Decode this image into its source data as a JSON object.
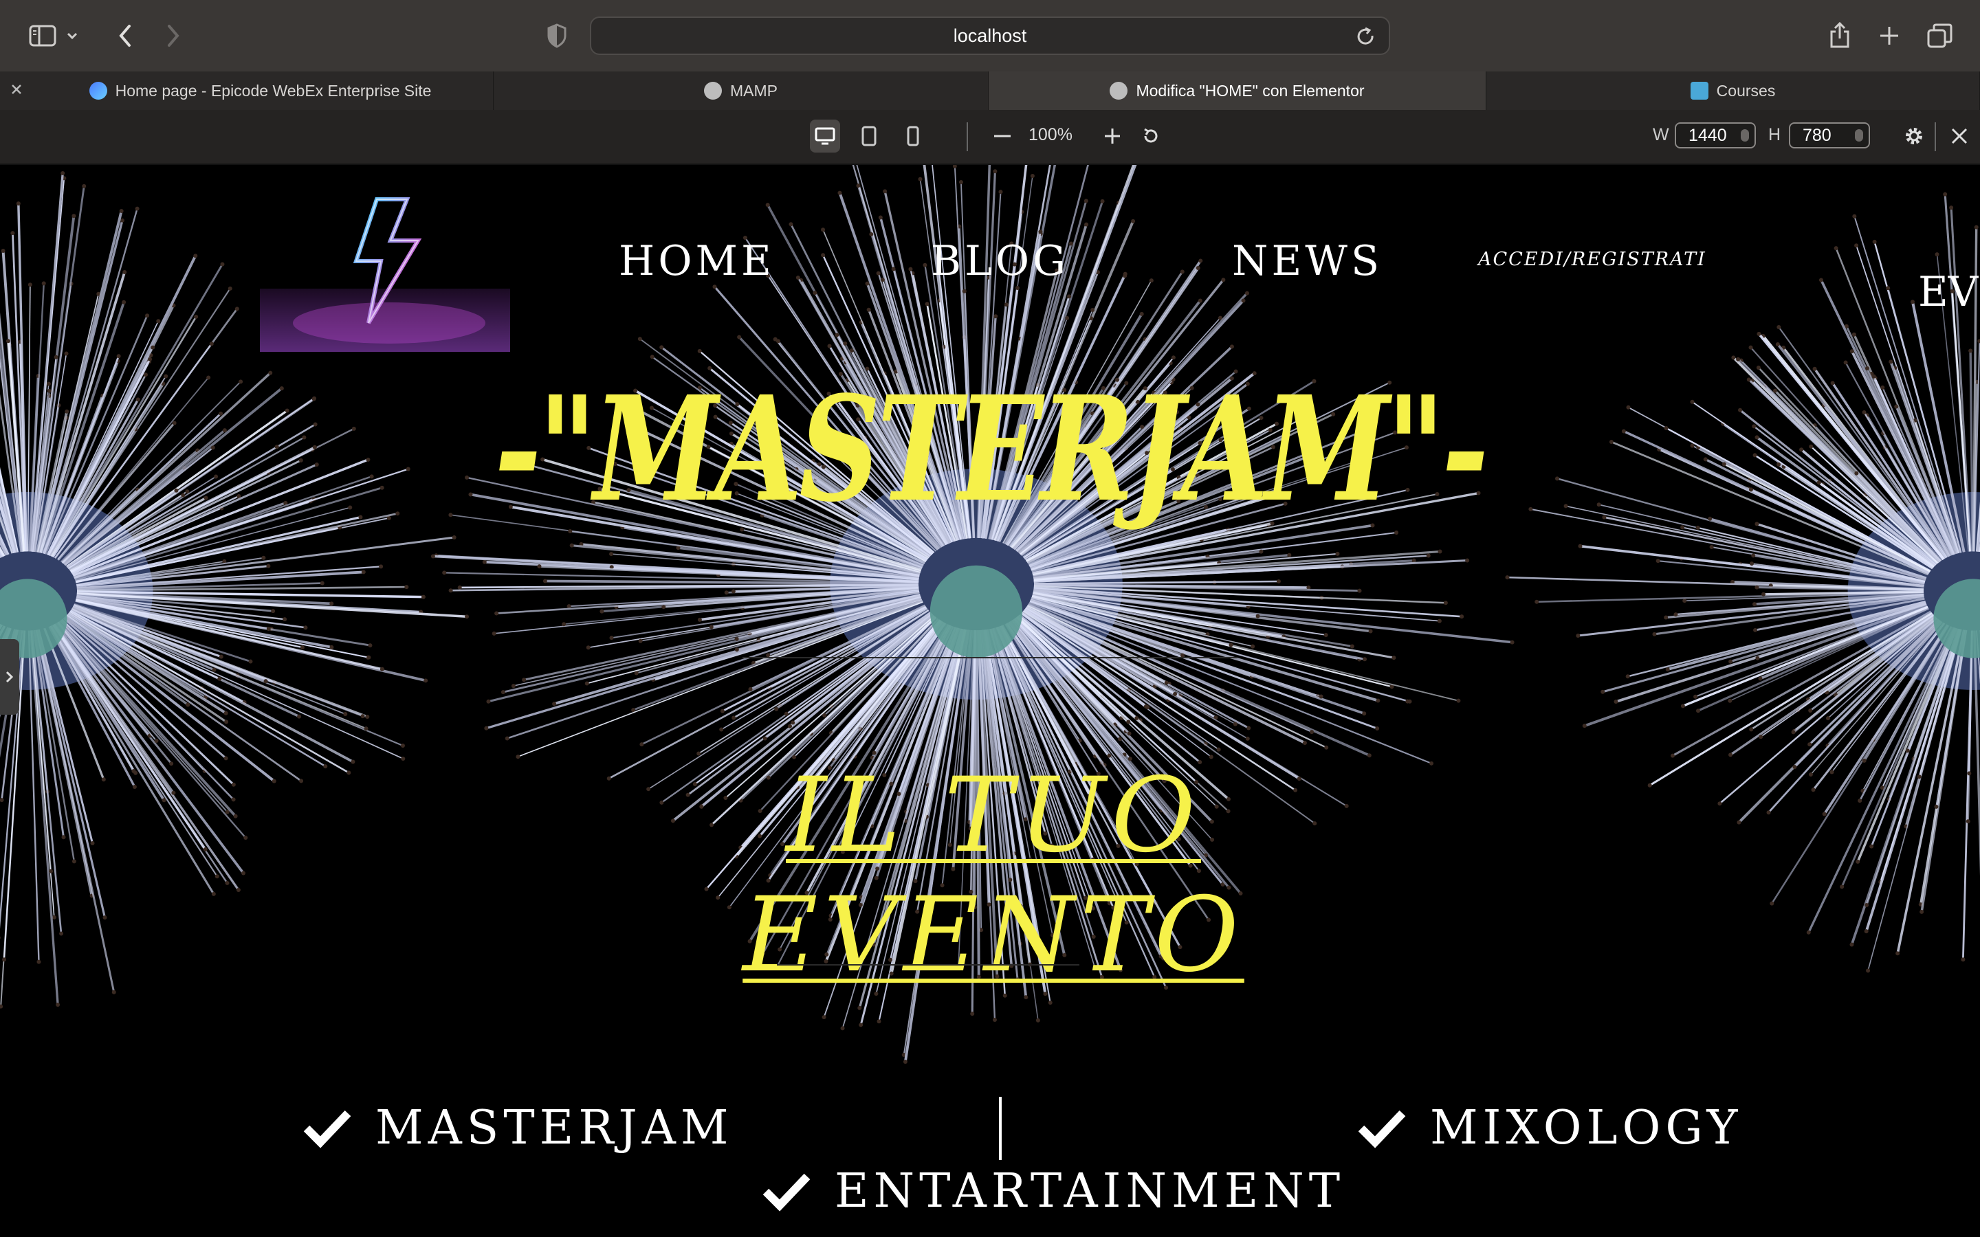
{
  "browser": {
    "address": "localhost",
    "tabs": [
      {
        "label": "Home page - Epicode WebEx Enterprise Site",
        "active": false
      },
      {
        "label": "MAMP",
        "active": false
      },
      {
        "label": "Modifica \"HOME\" con Elementor",
        "active": true
      },
      {
        "label": "Courses",
        "active": false
      }
    ],
    "responsive": {
      "zoom": "100%",
      "width_label": "W",
      "width_value": "1440",
      "height_label": "H",
      "height_value": "780"
    }
  },
  "site": {
    "nav": [
      "HOME",
      "BLOG",
      "NEWS"
    ],
    "login": "ACCEDI/REGISTRATI",
    "peek_text": "EV",
    "title": "-\"MASTERJAM\"-",
    "event_link": "IL TUO EVENTO",
    "features": [
      "MASTERJAM",
      "MIXOLOGY",
      "ENTARTAINMENT"
    ],
    "accent_color": "#f6f14a"
  },
  "icons": [
    "sidebar-icon",
    "chevron-down-icon",
    "back-icon",
    "forward-icon",
    "shield-icon",
    "reload-icon",
    "share-icon",
    "new-tab-icon",
    "tabs-overview-icon",
    "close-icon",
    "desktop-icon",
    "tablet-icon",
    "phone-icon",
    "zoom-out-icon",
    "zoom-in-icon",
    "rotate-icon",
    "gear-icon",
    "checkmark-icon",
    "lightning-logo"
  ]
}
